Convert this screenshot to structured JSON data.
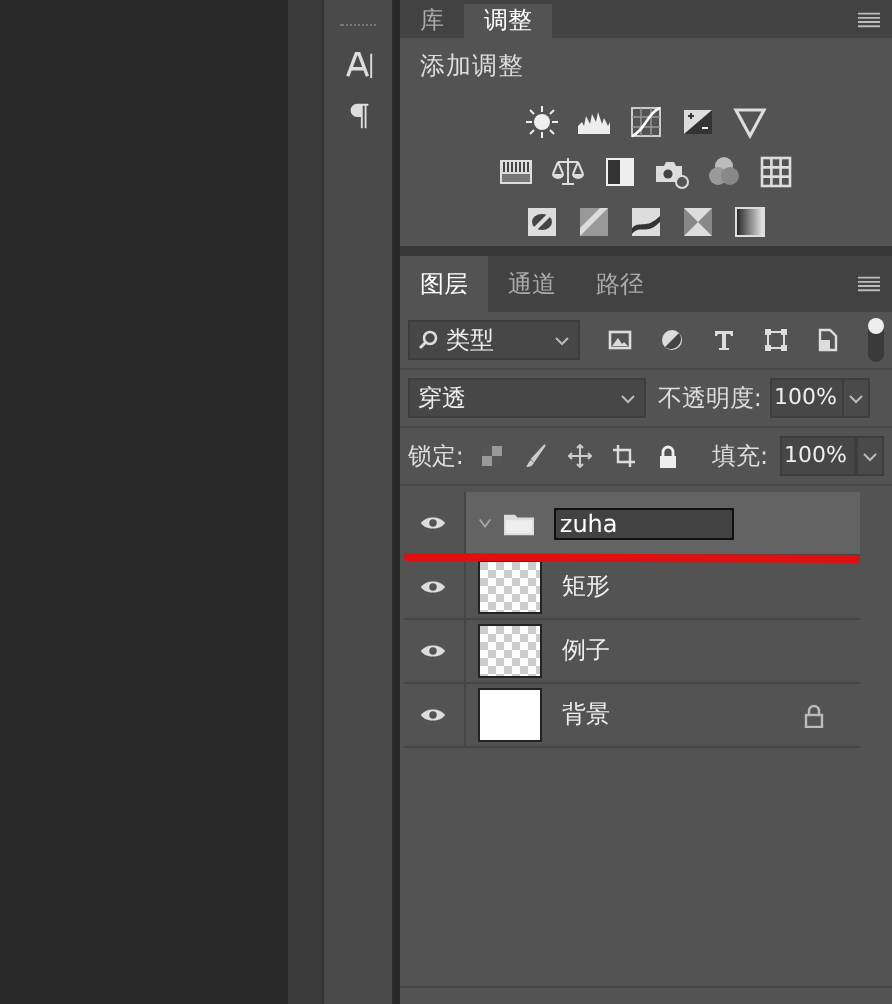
{
  "top_panel": {
    "tabs": [
      {
        "label": "库",
        "selected": false
      },
      {
        "label": "调整",
        "selected": true
      }
    ],
    "heading": "添加调整"
  },
  "layers_panel": {
    "tabs": [
      {
        "label": "图层",
        "selected": true
      },
      {
        "label": "通道",
        "selected": false
      },
      {
        "label": "路径",
        "selected": false
      }
    ],
    "filter": {
      "value": "类型"
    },
    "blend_mode": {
      "value": "穿透"
    },
    "opacity": {
      "label": "不透明度:",
      "value": "100%"
    },
    "lock": {
      "label": "锁定:"
    },
    "fill": {
      "label": "填充:",
      "value": "100%"
    },
    "layers": [
      {
        "kind": "group",
        "name": "zuha",
        "editing": true,
        "visible": true,
        "selected": true,
        "locked": false
      },
      {
        "kind": "layer",
        "name": "矩形",
        "visible": true,
        "selected": false,
        "locked": false
      },
      {
        "kind": "layer",
        "name": "例子",
        "visible": true,
        "selected": false,
        "locked": false
      },
      {
        "kind": "background",
        "name": "背景",
        "visible": true,
        "selected": false,
        "locked": true
      }
    ]
  }
}
